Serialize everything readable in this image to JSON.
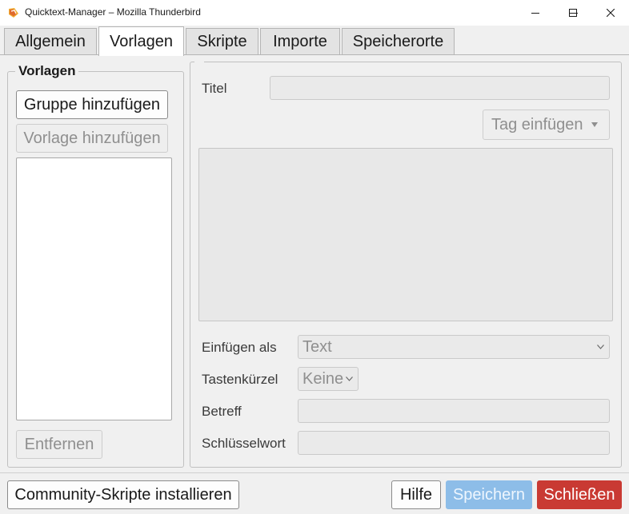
{
  "window": {
    "title": "Quicktext-Manager – Mozilla Thunderbird",
    "controls": [
      "minimize-icon",
      "maximize-icon",
      "close-icon"
    ]
  },
  "tabs": [
    {
      "label": "Allgemein",
      "active": false
    },
    {
      "label": "Vorlagen",
      "active": true
    },
    {
      "label": "Skripte",
      "active": false
    },
    {
      "label": "Importe",
      "active": false
    },
    {
      "label": "Speicherorte",
      "active": false
    }
  ],
  "left": {
    "legend": "Vorlagen",
    "add_group_label": "Gruppe hinzufügen",
    "add_template_label": "Vorlage hinzufügen",
    "remove_label": "Entfernen"
  },
  "editor": {
    "title_label": "Titel",
    "title_value": "",
    "insert_tag_label": "Tag einfügen",
    "body_value": "",
    "insert_as_label": "Einfügen als",
    "insert_as_value": "Text",
    "shortcut_label": "Tastenkürzel",
    "shortcut_value": "Keine",
    "subject_label": "Betreff",
    "subject_value": "",
    "keyword_label": "Schlüsselwort",
    "keyword_value": ""
  },
  "footer": {
    "community_label": "Community-Skripte installieren",
    "help_label": "Hilfe",
    "save_label": "Speichern",
    "close_label": "Schließen"
  },
  "colors": {
    "save_button": "#8dbde8",
    "close_button": "#c93a33",
    "background": "#f0f0f0"
  }
}
